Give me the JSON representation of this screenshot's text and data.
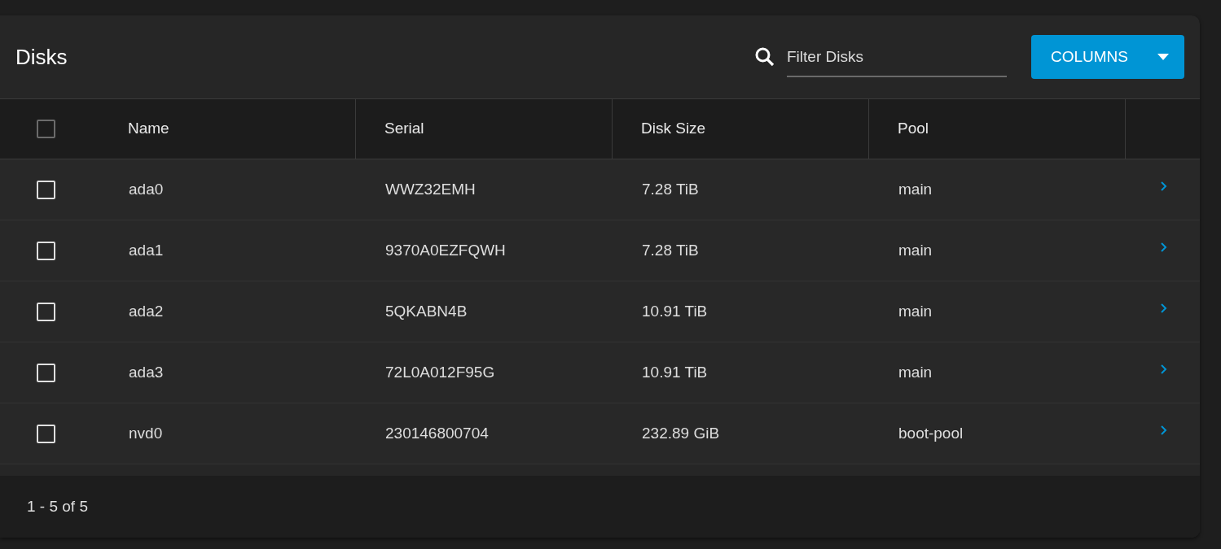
{
  "title": "Disks",
  "filter": {
    "placeholder": "Filter Disks"
  },
  "columns_button": {
    "label": "COLUMNS"
  },
  "table": {
    "select_all": {
      "checked": false
    },
    "columns": [
      "Name",
      "Serial",
      "Disk Size",
      "Pool"
    ],
    "rows": [
      {
        "checked": false,
        "cells": [
          "ada0",
          "WWZ32EMH",
          "7.28 TiB",
          "main"
        ]
      },
      {
        "checked": false,
        "cells": [
          "ada1",
          "9370A0EZFQWH",
          "7.28 TiB",
          "main"
        ]
      },
      {
        "checked": false,
        "cells": [
          "ada2",
          "5QKABN4B",
          "10.91 TiB",
          "main"
        ]
      },
      {
        "checked": false,
        "cells": [
          "ada3",
          "72L0A012F95G",
          "10.91 TiB",
          "main"
        ]
      },
      {
        "checked": false,
        "cells": [
          "nvd0",
          "230146800704",
          "232.89 GiB",
          "boot-pool"
        ]
      }
    ]
  },
  "pagination": "1 - 5 of 5"
}
